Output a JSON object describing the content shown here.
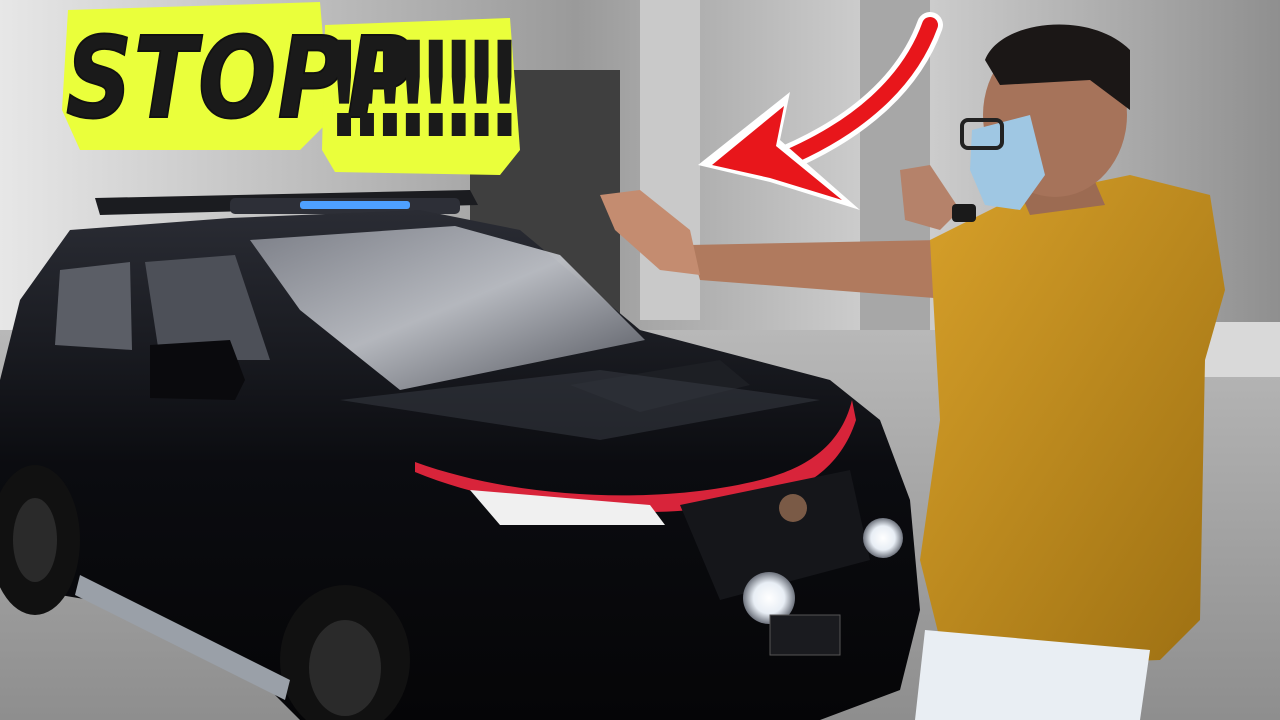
{
  "caption": {
    "word": "STOPP",
    "exclamations": "!!!!!!!!",
    "highlight_color": "#eaff3b",
    "text_color": "#1a1a1a"
  },
  "colors": {
    "arrow": "#e8161b",
    "car_body": "#0c0d12",
    "car_accent": "#d8243a",
    "shirt": "#c28e1c",
    "mask": "#9fc7e3"
  }
}
